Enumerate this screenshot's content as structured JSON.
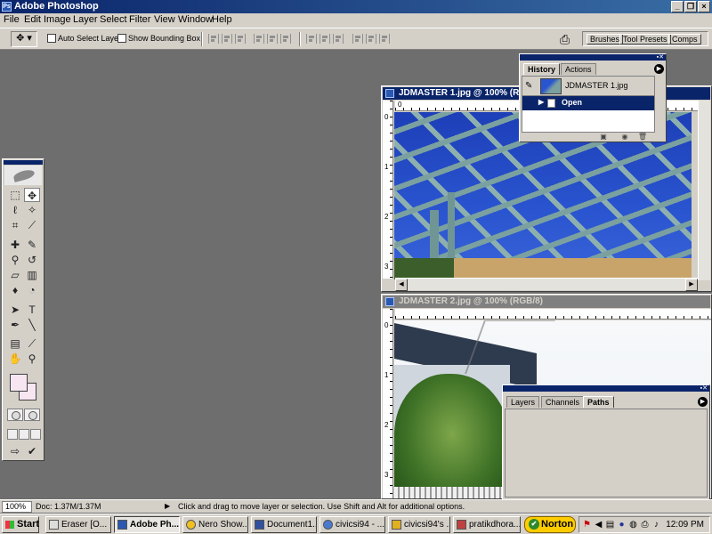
{
  "app": {
    "title": "Adobe Photoshop"
  },
  "window_controls": {
    "minimize": "_",
    "restore": "❐",
    "close": "×"
  },
  "menu": [
    "File",
    "Edit",
    "Image",
    "Layer",
    "Select",
    "Filter",
    "View",
    "Window",
    "Help"
  ],
  "options_bar": {
    "tool_icon": "move-tool-icon",
    "auto_select_label": "Auto Select Layer",
    "show_bounding_label": "Show Bounding Box",
    "auto_select_checked": false,
    "show_bounding_checked": false
  },
  "palette_well": {
    "tabs": [
      "Brushes",
      "Tool Presets",
      "Comps"
    ]
  },
  "toolbox": {
    "tools": [
      "marquee-tool-icon",
      "move-tool-icon",
      "lasso-tool-icon",
      "magic-wand-icon",
      "crop-tool-icon",
      "slice-tool-icon",
      "healing-brush-icon",
      "brush-tool-icon",
      "clone-stamp-icon",
      "history-brush-icon",
      "eraser-icon",
      "gradient-icon",
      "blur-icon",
      "dodge-icon",
      "path-select-icon",
      "type-tool-icon",
      "pen-tool-icon",
      "line-tool-icon",
      "notes-icon",
      "eyedropper-icon",
      "hand-tool-icon",
      "zoom-tool-icon"
    ],
    "foreground_color": "#f7e6f2",
    "background_color": "#f7e6f2"
  },
  "documents": [
    {
      "title": "JDMASTER 1.jpg @ 100% (RGB/8)",
      "title_visible": "JDMASTER 1.jpg @ 100% (RGB...",
      "active": true,
      "ruler_v": [
        "0",
        "1",
        "2",
        "3"
      ]
    },
    {
      "title": "JDMASTER 2.jpg @ 100% (RGB/8)",
      "active": false,
      "ruler_v": [
        "0",
        "1",
        "2",
        "3"
      ]
    }
  ],
  "history_panel": {
    "tabs": [
      "History",
      "Actions"
    ],
    "active_tab": "History",
    "snapshot": "JDMASTER 1.jpg",
    "steps": [
      "Open"
    ]
  },
  "layers_panel": {
    "tabs": [
      "Layers",
      "Channels",
      "Paths"
    ],
    "active_tab": "Paths"
  },
  "status_bar": {
    "zoom": "100%",
    "doc_info": "Doc: 1.37M/1.37M",
    "hint": "Click and drag to move layer or selection.  Use Shift and Alt for additional options."
  },
  "taskbar": {
    "start": "Start",
    "tasks": [
      {
        "label": "Eraser [O...",
        "active": false
      },
      {
        "label": "Adobe Ph...",
        "active": true
      },
      {
        "label": "Nero Show...",
        "active": false
      },
      {
        "label": "Document1...",
        "active": false
      },
      {
        "label": "civicsi94 - ...",
        "active": false
      },
      {
        "label": "civicsi94's ...",
        "active": false
      },
      {
        "label": "pratikdhora...",
        "active": false
      }
    ],
    "norton": "Norton",
    "clock": "12:09 PM"
  }
}
